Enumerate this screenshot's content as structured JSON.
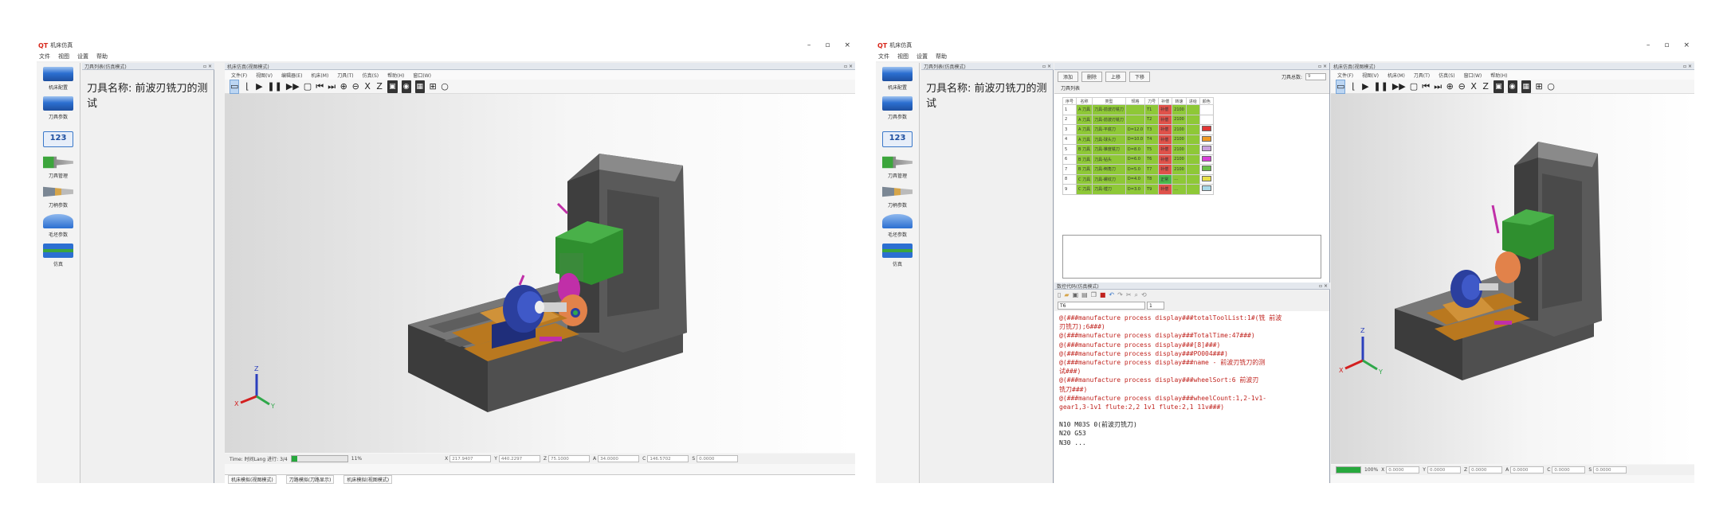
{
  "app": {
    "logo": "QT",
    "title": "机床仿真",
    "menu": [
      "文件",
      "视图",
      "设置",
      "帮助"
    ],
    "window_controls": [
      "–",
      "▫",
      "×"
    ]
  },
  "sidebar": {
    "items": [
      {
        "label": "机床配置",
        "color": "#2c6fd1"
      },
      {
        "label": "刀具参数",
        "color": "#2c6fd1"
      },
      {
        "label": "123",
        "color": "#3a78c9"
      },
      {
        "label": "刀具管理",
        "color": "#3ca53c"
      },
      {
        "label": "刀柄参数",
        "color": "#7b8794"
      },
      {
        "label": "毛坯参数",
        "color": "#2c6fd1"
      },
      {
        "label": "仿真",
        "color": "#2c6fd1"
      }
    ]
  },
  "left_window": {
    "tool_panel_title": "刀具列表(仿真模式)",
    "view_panel_title": "机床仿真(视图模式)",
    "tool_name": "刀具名称: 前波刃铣刀的测试",
    "tabs": [
      "文件(F)",
      "视图(V)",
      "编辑器(E)",
      "机床(M)",
      "刀具(T)",
      "仿真(S)",
      "帮助(H)",
      "窗口(W)"
    ],
    "toolbar": [
      "▶",
      "❚❚",
      "▶▶",
      "▢",
      "⏮",
      "⏭",
      "⊕",
      "⊖",
      "X",
      "Z",
      "▣",
      "◉",
      "▦",
      "⊞",
      "○"
    ],
    "status": {
      "time_label": "Time: 时间Lang 进行: 3/4",
      "progress_pct": 11,
      "progress_text": "11%",
      "coords": [
        {
          "axis": "X",
          "value": "217.9407"
        },
        {
          "axis": "Y",
          "value": "440.2297"
        },
        {
          "axis": "Z",
          "value": "75.1000"
        },
        {
          "axis": "A",
          "value": "34.0000"
        },
        {
          "axis": "C",
          "value": "146.5702"
        },
        {
          "axis": "S",
          "value": "0.0000"
        }
      ]
    },
    "bottom_tabs": [
      "机床模拟(视图模式)",
      "刀路模拟(刀路显示)",
      "机床模拟(视图模式)"
    ]
  },
  "right_window": {
    "tool_panel_title": "刀具列表(仿真模式)",
    "tool_name": "刀具名称: 前波刃铣刀的测试",
    "table_buttons": [
      "添加",
      "删除",
      "上移",
      "下移"
    ],
    "tool_count_label": "刀具总数:",
    "tool_count_value": "9",
    "table_tab": "刀具列表",
    "table_headers": [
      "序号",
      "名称",
      "类型",
      "规格",
      "刀号",
      "补偿",
      "转速",
      "进给",
      "颜色"
    ],
    "table_rows": [
      {
        "n": "1",
        "name": "A 刀具",
        "type": "刀具-前波刃铣刀",
        "spec": "",
        "no": "T1",
        "comp": "补偿",
        "s": "2100",
        "f": "",
        "color": ""
      },
      {
        "n": "2",
        "name": "A 刀具",
        "type": "刀具-前波刃铣刀",
        "spec": "",
        "no": "T2",
        "comp": "补偿",
        "s": "2100",
        "f": "",
        "color": ""
      },
      {
        "n": "3",
        "name": "A 刀具",
        "type": "刀具-平底刀",
        "spec": "D=12.0",
        "no": "T3",
        "comp": "补偿",
        "s": "2100",
        "f": "",
        "color": "#e23636"
      },
      {
        "n": "4",
        "name": "A 刀具",
        "type": "刀具-球头刀",
        "spec": "D=10.0",
        "no": "T4",
        "comp": "补偿",
        "s": "2100",
        "f": "",
        "color": "#f09a24"
      },
      {
        "n": "5",
        "name": "B 刀具",
        "type": "刀具-锥度铣刀",
        "spec": "D=8.0",
        "no": "T5",
        "comp": "补偿",
        "s": "2100",
        "f": "",
        "color": "#c9a0dc"
      },
      {
        "n": "6",
        "name": "B 刀具",
        "type": "刀具-钻头",
        "spec": "D=6.0",
        "no": "T6",
        "comp": "补偿",
        "s": "2100",
        "f": "",
        "color": "#d83fd8"
      },
      {
        "n": "7",
        "name": "B 刀具",
        "type": "刀具-倒角刀",
        "spec": "D=5.0",
        "no": "T7",
        "comp": "补偿",
        "s": "2100",
        "f": "",
        "color": "#6cc04a"
      },
      {
        "n": "8",
        "name": "C 刀具",
        "type": "刀具-螺纹刀",
        "spec": "D=4.0",
        "no": "T8",
        "comp": "正常",
        "s": "...",
        "f": "",
        "color": "#e8e04a"
      },
      {
        "n": "9",
        "name": "C 刀具",
        "type": "刀具-镗刀",
        "spec": "D=3.0",
        "no": "T9",
        "comp": "补偿",
        "s": "...",
        "f": "",
        "color": "#a8d8e8"
      }
    ],
    "code_panel_title": "数控代码(仿真模式)",
    "code_select": [
      "T6",
      "1"
    ],
    "code_lines": [
      {
        "cls": "red",
        "text": "@(###manufacture process display###totalToolList:1#(铣 前波"
      },
      {
        "cls": "red",
        "text": "刃铣刀);6###)"
      },
      {
        "cls": "red",
        "text": "@(###manufacture process display###TotalTime:47###)"
      },
      {
        "cls": "red",
        "text": "@(###manufacture process display###[8]###)"
      },
      {
        "cls": "red",
        "text": "@(###manufacture process display###PO004###)"
      },
      {
        "cls": "red",
        "text": "@(###manufacture process display###name - 前波刃铣刀的测"
      },
      {
        "cls": "red",
        "text": "试###)"
      },
      {
        "cls": "red",
        "text": "@(###manufacture process display###wheelSort:6 前波刃"
      },
      {
        "cls": "red",
        "text": "铣刀###)"
      },
      {
        "cls": "red",
        "text": "@(###manufacture process display###wheelCount:1,2-1v1-"
      },
      {
        "cls": "red",
        "text": "gear1,3-1v1 flute:2,2 1v1 flute:2,1 11v###)"
      },
      {
        "cls": "blk",
        "text": ""
      },
      {
        "cls": "blk",
        "text": "N10    M03S  0(前波刃铣刀)"
      },
      {
        "cls": "blk",
        "text": "N20    G53"
      },
      {
        "cls": "blk",
        "text": "N30    ..."
      }
    ],
    "view_panel_title": "机床仿真(视图模式)",
    "tabs": [
      "文件(F)",
      "视图(V)",
      "机床(M)",
      "刀具(T)",
      "仿真(S)",
      "窗口(W)",
      "帮助(H)"
    ],
    "toolbar": [
      "▶",
      "❚❚",
      "▶▶",
      "▢",
      "⏮",
      "⏭",
      "⊕",
      "⊖",
      "X",
      "Z",
      "▣",
      "◉",
      "▦",
      "⊞",
      "○"
    ],
    "status": {
      "progress_pct": 100,
      "progress_text": "100%",
      "coords": [
        {
          "axis": "X",
          "value": "0.0000"
        },
        {
          "axis": "Y",
          "value": "0.0000"
        },
        {
          "axis": "Z",
          "value": "0.0000"
        },
        {
          "axis": "A",
          "value": "0.0000"
        },
        {
          "axis": "C",
          "value": "0.0000"
        },
        {
          "axis": "S",
          "value": "0.0000"
        }
      ]
    }
  },
  "axis_gizmo": {
    "x": "X",
    "y": "Y",
    "z": "Z"
  },
  "colors": {
    "machine_body": "#5a5a5a",
    "spindle_head": "#2f8f2f",
    "fixture_blue": "#2b3f9e",
    "rails": "#b9781f",
    "accent_pink": "#c02fa8",
    "tool_orange": "#e2824a"
  }
}
